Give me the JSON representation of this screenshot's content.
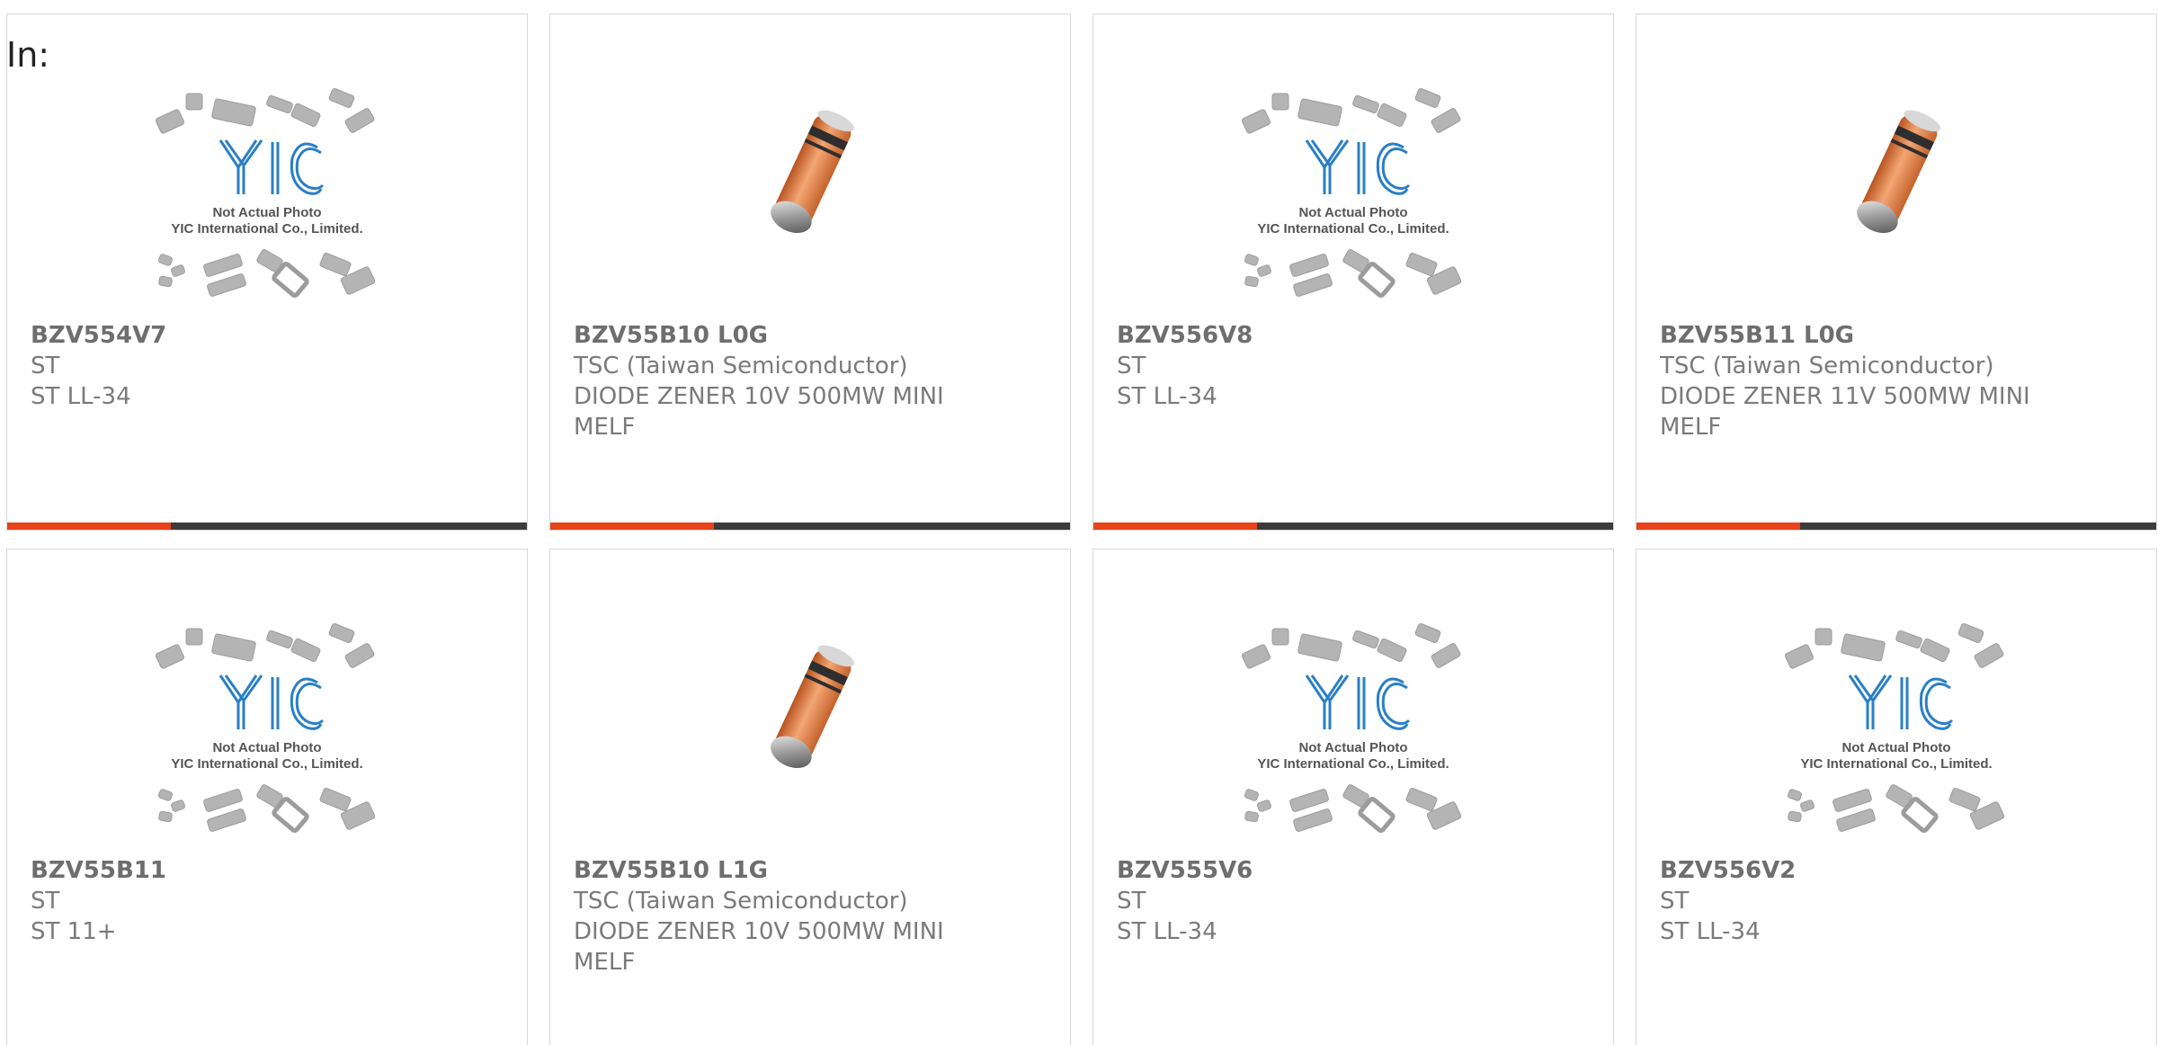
{
  "prefix_label": "In:",
  "colors": {
    "accent": "#e8431a",
    "bar": "#3c3c3c",
    "text": "#7a7a7a",
    "logo": "#2a7fc6"
  },
  "placeholder_text": {
    "line1": "Not Actual Photo",
    "line2": "YIC International Co., Limited."
  },
  "products": [
    {
      "part": "BZV554V7",
      "maker": "ST",
      "desc": "ST LL-34",
      "image": "placeholder"
    },
    {
      "part": "BZV55B10 L0G",
      "maker": "TSC (Taiwan Semiconductor)",
      "desc": "DIODE ZENER 10V 500MW MINI MELF",
      "image": "diode"
    },
    {
      "part": "BZV556V8",
      "maker": "ST",
      "desc": "ST LL-34",
      "image": "placeholder"
    },
    {
      "part": "BZV55B11 L0G",
      "maker": "TSC (Taiwan Semiconductor)",
      "desc": "DIODE ZENER 11V 500MW MINI MELF",
      "image": "diode"
    },
    {
      "part": "BZV55B11",
      "maker": "ST",
      "desc": "ST 11+",
      "image": "placeholder"
    },
    {
      "part": "BZV55B10 L1G",
      "maker": "TSC (Taiwan Semiconductor)",
      "desc": "DIODE ZENER 10V 500MW MINI MELF",
      "image": "diode"
    },
    {
      "part": "BZV555V6",
      "maker": "ST",
      "desc": "ST LL-34",
      "image": "placeholder"
    },
    {
      "part": "BZV556V2",
      "maker": "ST",
      "desc": "ST LL-34",
      "image": "placeholder"
    }
  ]
}
